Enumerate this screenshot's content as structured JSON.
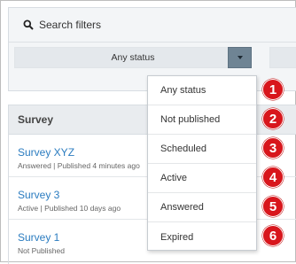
{
  "filters": {
    "search_label": "Search filters",
    "status_selected": "Any status"
  },
  "table": {
    "header": "Survey",
    "rows": [
      {
        "title": "Survey XYZ",
        "meta": "Answered | Published 4 minutes ago"
      },
      {
        "title": "Survey 3",
        "meta": "Active | Published 10 days ago"
      },
      {
        "title": "Survey 1",
        "meta": "Not Published"
      }
    ]
  },
  "status_menu": {
    "options": [
      "Any status",
      "Not published",
      "Scheduled",
      "Active",
      "Answered",
      "Expired"
    ]
  },
  "callouts": [
    "1",
    "2",
    "3",
    "4",
    "5",
    "6"
  ],
  "colors": {
    "link": "#2b7cc0",
    "badge": "#d8161c",
    "caret_button": "#6f8494"
  }
}
